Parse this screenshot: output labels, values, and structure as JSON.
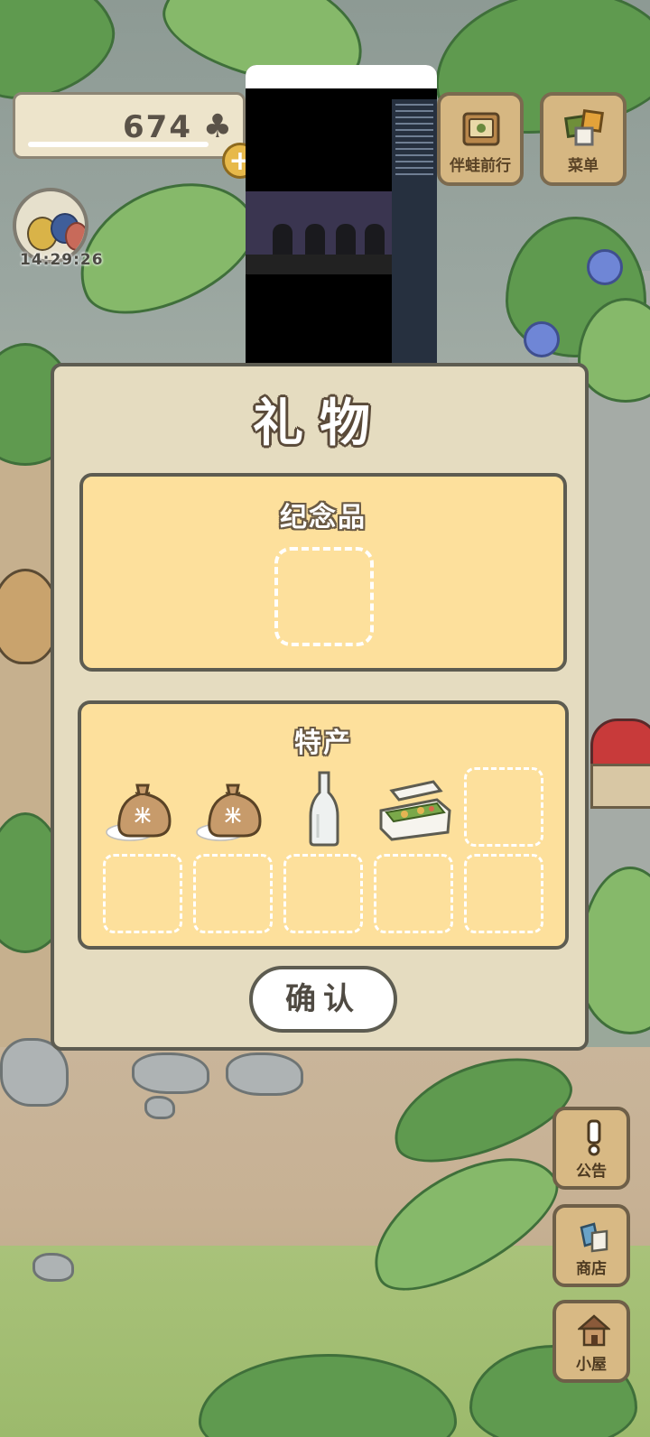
{
  "hud": {
    "clover_count": "674",
    "clover_icon": "clover-icon",
    "timer": "14:29:26"
  },
  "top_buttons": {
    "travel_label": "伴蛙前行",
    "menu_label": "菜单"
  },
  "side_buttons": {
    "notice_label": "公告",
    "shop_label": "商店",
    "house_label": "小屋"
  },
  "dialog": {
    "title": "礼物",
    "souvenir_title": "纪念品",
    "specialty_title": "特产",
    "specialty_items": [
      "rice-sack",
      "rice-sack",
      "glass-bottle",
      "bento-box"
    ],
    "confirm_label": "确认"
  },
  "colors": {
    "dialog_bg": "#e5dcc0",
    "panel_bg": "#fde09c",
    "outline": "#5d5c51",
    "button_wood": "#d6b782"
  }
}
